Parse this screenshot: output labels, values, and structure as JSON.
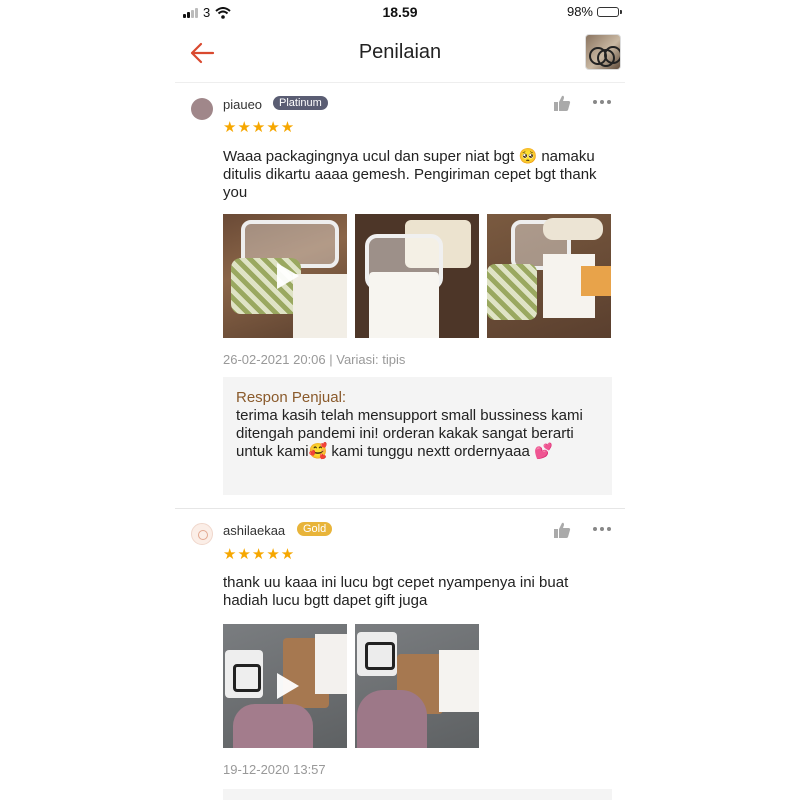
{
  "status_bar": {
    "carrier": "3",
    "time": "18.59",
    "battery": "98%",
    "battery_level": 0.98
  },
  "header": {
    "title": "Penilaian",
    "back_icon": "arrow-left-icon",
    "accent": "#d9492f"
  },
  "reviews": [
    {
      "username": "piaueo",
      "badge": "Platinum",
      "badge_color": "#5a5d73",
      "rating": 5,
      "stars": "★★★★★",
      "comment": "Waaa packagingnya ucul dan super niat bgt 🥺 namaku ditulis dikartu aaaa gemesh. Pengiriman cepet bgt thank you",
      "meta": "26-02-2021 20:06 | Variasi: tipis",
      "reply": {
        "title": "Respon Penjual:",
        "text": "terima kasih telah mensupport small bussiness kami ditengah pandemi ini! orderan kakak sangat berarti untuk kami🥰 kami tunggu nextt ordernyaaa 💕"
      }
    },
    {
      "username": "ashilaekaa",
      "badge": "Gold",
      "badge_color": "#e8b43a",
      "rating": 5,
      "stars": "★★★★★",
      "comment": "thank uu kaaa ini lucu bgt cepet nyampenya ini buat hadiah lucu bgtt dapet gift juga",
      "meta": "19-12-2020 13:57"
    }
  ]
}
